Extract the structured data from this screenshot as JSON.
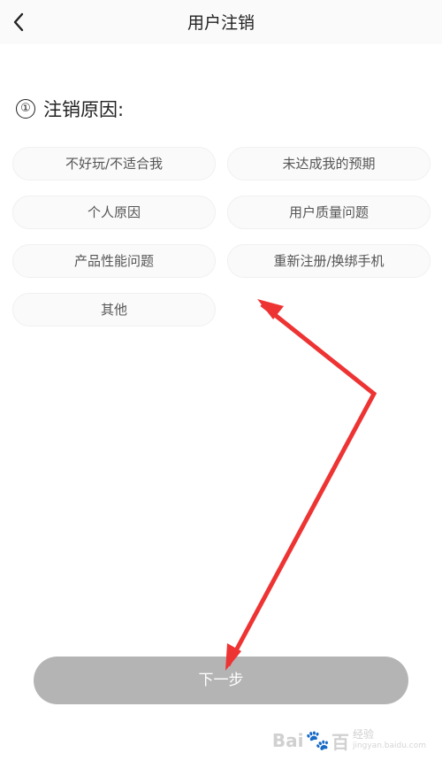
{
  "header": {
    "title": "用户注销",
    "back_icon": "chevron-left-icon"
  },
  "section": {
    "number": "①",
    "label": "注销原因:"
  },
  "reasons": [
    "不好玩/不适合我",
    "未达成我的预期",
    "个人原因",
    "用户质量问题",
    "产品性能问题",
    "重新注册/换绑手机",
    "其他"
  ],
  "footer": {
    "next_label": "下一步"
  },
  "annotation": {
    "arrow_color": "#ee3333"
  },
  "watermark": {
    "logo": "Bai",
    "logo_tail": "百",
    "cn": "经验",
    "url": "jingyan.baidu.com"
  }
}
